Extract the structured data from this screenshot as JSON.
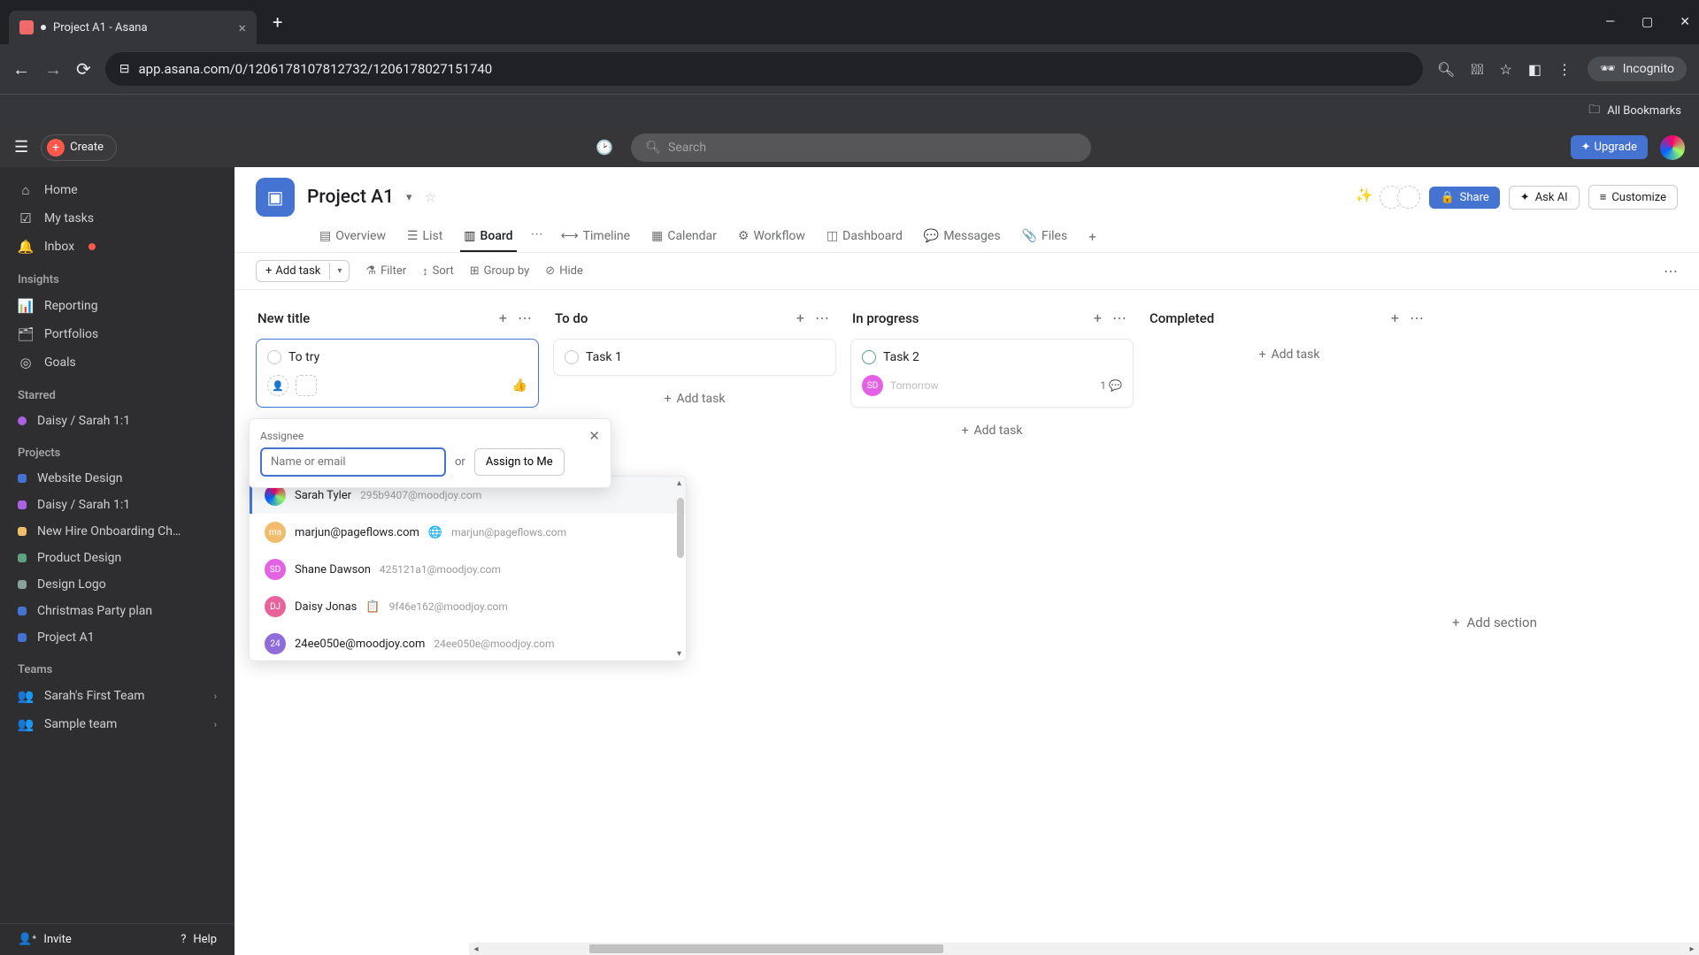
{
  "browser": {
    "tab_title": "Project A1 - Asana",
    "url": "app.asana.com/0/1206178107812732/1206178027151740",
    "incognito": "Incognito",
    "all_bookmarks": "All Bookmarks"
  },
  "topbar": {
    "create": "Create",
    "search_placeholder": "Search",
    "upgrade": "Upgrade"
  },
  "sidebar": {
    "home": "Home",
    "my_tasks": "My tasks",
    "inbox": "Inbox",
    "insights_heading": "Insights",
    "reporting": "Reporting",
    "portfolios": "Portfolios",
    "goals": "Goals",
    "starred_heading": "Starred",
    "starred_item": "Daisy / Sarah 1:1",
    "projects_heading": "Projects",
    "projects": [
      {
        "name": "Website Design",
        "color": "#4573d2"
      },
      {
        "name": "Daisy / Sarah 1:1",
        "color": "#a962e0"
      },
      {
        "name": "New Hire Onboarding Ch…",
        "color": "#f1bd6c"
      },
      {
        "name": "Product Design",
        "color": "#5da283"
      },
      {
        "name": "Design Logo",
        "color": "#8d9f9b"
      },
      {
        "name": "Christmas Party plan",
        "color": "#4573d2"
      },
      {
        "name": "Project A1",
        "color": "#4573d2"
      }
    ],
    "teams_heading": "Teams",
    "teams": [
      {
        "name": "Sarah's First Team"
      },
      {
        "name": "Sample team"
      }
    ],
    "invite": "Invite",
    "help": "Help"
  },
  "project": {
    "title": "Project A1",
    "share": "Share",
    "ask_ai": "Ask AI",
    "customize": "Customize",
    "tabs": {
      "overview": "Overview",
      "list": "List",
      "board": "Board",
      "timeline": "Timeline",
      "calendar": "Calendar",
      "workflow": "Workflow",
      "dashboard": "Dashboard",
      "messages": "Messages",
      "files": "Files"
    }
  },
  "toolbar": {
    "add_task": "Add task",
    "filter": "Filter",
    "sort": "Sort",
    "group_by": "Group by",
    "hide": "Hide"
  },
  "board": {
    "columns": [
      {
        "title": "New title",
        "cards": [
          {
            "title": "To try"
          }
        ]
      },
      {
        "title": "To do",
        "cards": [
          {
            "title": "Task 1"
          }
        ],
        "add": "Add task"
      },
      {
        "title": "In progress",
        "cards": [
          {
            "title": "Task 2",
            "assignee_initials": "SD",
            "assignee_color": "#e362e3",
            "due": "Tomorrow",
            "comments": "1"
          }
        ],
        "add": "Add task"
      },
      {
        "title": "Completed",
        "add": "Add task"
      }
    ],
    "add_section": "Add section"
  },
  "assignee_popup": {
    "label": "Assignee",
    "placeholder": "Name or email",
    "or": "or",
    "assign_me": "Assign to Me",
    "options": [
      {
        "name": "Sarah Tyler",
        "email": "295b9407@moodjoy.com",
        "color": "#ffffff",
        "av_text": "",
        "av_style": "gradient"
      },
      {
        "name": "marjun@pageflows.com",
        "email": "marjun@pageflows.com",
        "color": "#f1bd6c",
        "av_text": "ma",
        "extra": "🌐"
      },
      {
        "name": "Shane Dawson",
        "email": "425121a1@moodjoy.com",
        "color": "#e362e3",
        "av_text": "SD"
      },
      {
        "name": "Daisy Jonas",
        "email": "9f46e162@moodjoy.com",
        "color": "#e8639b",
        "av_text": "DJ",
        "extra": "📋"
      },
      {
        "name": "24ee050e@moodjoy.com",
        "email": "24ee050e@moodjoy.com",
        "color": "#8e6cd9",
        "av_text": "24"
      }
    ]
  }
}
